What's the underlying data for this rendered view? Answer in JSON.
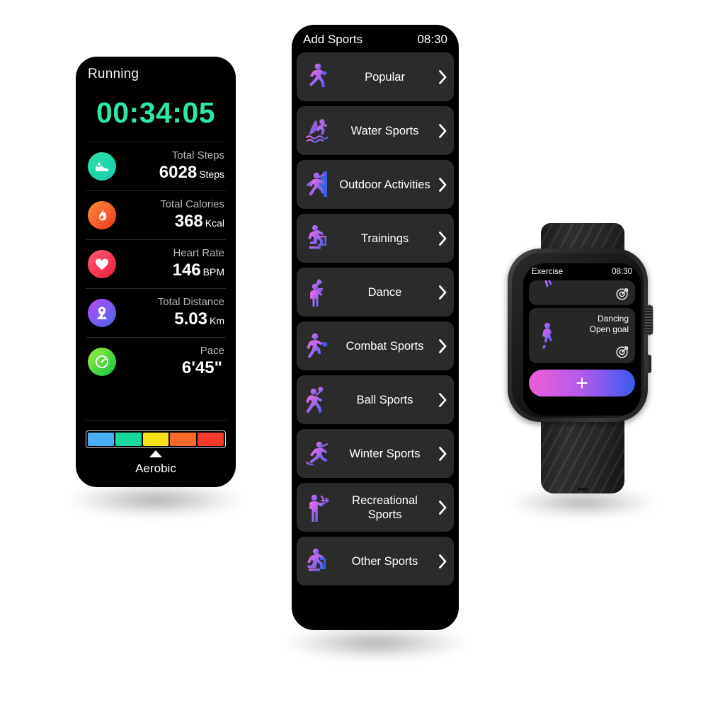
{
  "running_panel": {
    "title": "Running",
    "timer": "00:34:05",
    "timer_color": "#2ee6a8",
    "stats": [
      {
        "icon": "shoe-icon",
        "label": "Total Steps",
        "value": "6028",
        "unit": "Steps",
        "color_a": "#2fe0a6",
        "color_b": "#1fd1ac"
      },
      {
        "icon": "flame-icon",
        "label": "Total Calories",
        "value": "368",
        "unit": "Kcal",
        "color_a": "#ff7a3d",
        "color_b": "#f4452a"
      },
      {
        "icon": "heart-icon",
        "label": "Heart Rate",
        "value": "146",
        "unit": "BPM",
        "color_a": "#ff5a6e",
        "color_b": "#f5243f"
      },
      {
        "icon": "location-icon",
        "label": "Total Distance",
        "value": "5.03",
        "unit": "Km",
        "color_a": "#a855f7",
        "color_b": "#4f63e8"
      },
      {
        "icon": "speedometer-icon",
        "label": "Pace",
        "value": "6'45\"",
        "unit": "",
        "color_a": "#86e83a",
        "color_b": "#1fc94a"
      }
    ],
    "zone_bar": {
      "segments": [
        "#4aaef5",
        "#17d9a0",
        "#f7e016",
        "#f96a2a",
        "#f5392b"
      ],
      "marker_segment_index": 2,
      "zone_name": "Aerobic"
    }
  },
  "sports_panel": {
    "header": {
      "title": "Add Sports",
      "time": "08:30"
    },
    "items": [
      {
        "icon": "runner-icon",
        "label": "Popular"
      },
      {
        "icon": "windsurf-icon",
        "label": "Water Sports"
      },
      {
        "icon": "climber-icon",
        "label": "Outdoor Activities"
      },
      {
        "icon": "rowing-icon",
        "label": "Trainings"
      },
      {
        "icon": "dancer-flag-icon",
        "label": "Dance"
      },
      {
        "icon": "boxer-icon",
        "label": "Combat Sports"
      },
      {
        "icon": "volleyball-icon",
        "label": "Ball Sports"
      },
      {
        "icon": "skater-icon",
        "label": "Winter Sports"
      },
      {
        "icon": "archer-icon",
        "label": "Recreational Sports"
      },
      {
        "icon": "exercise-bike-icon",
        "label": "Other Sports"
      }
    ],
    "chevron_icon": "chevron-right-icon"
  },
  "watch": {
    "header": {
      "title": "Exercise",
      "time": "08:30"
    },
    "cards": [
      {
        "title": "",
        "subtitle": "",
        "icon": "partial-activity-icon",
        "goal_icon": "target-goal-icon"
      },
      {
        "title": "Dancing",
        "subtitle": "Open goal",
        "icon": "dancer-icon",
        "goal_icon": "target-goal-icon"
      }
    ],
    "add_button": {
      "icon": "plus-icon",
      "gradient_from": "#f05fd8",
      "gradient_to": "#3b5bf0"
    }
  }
}
